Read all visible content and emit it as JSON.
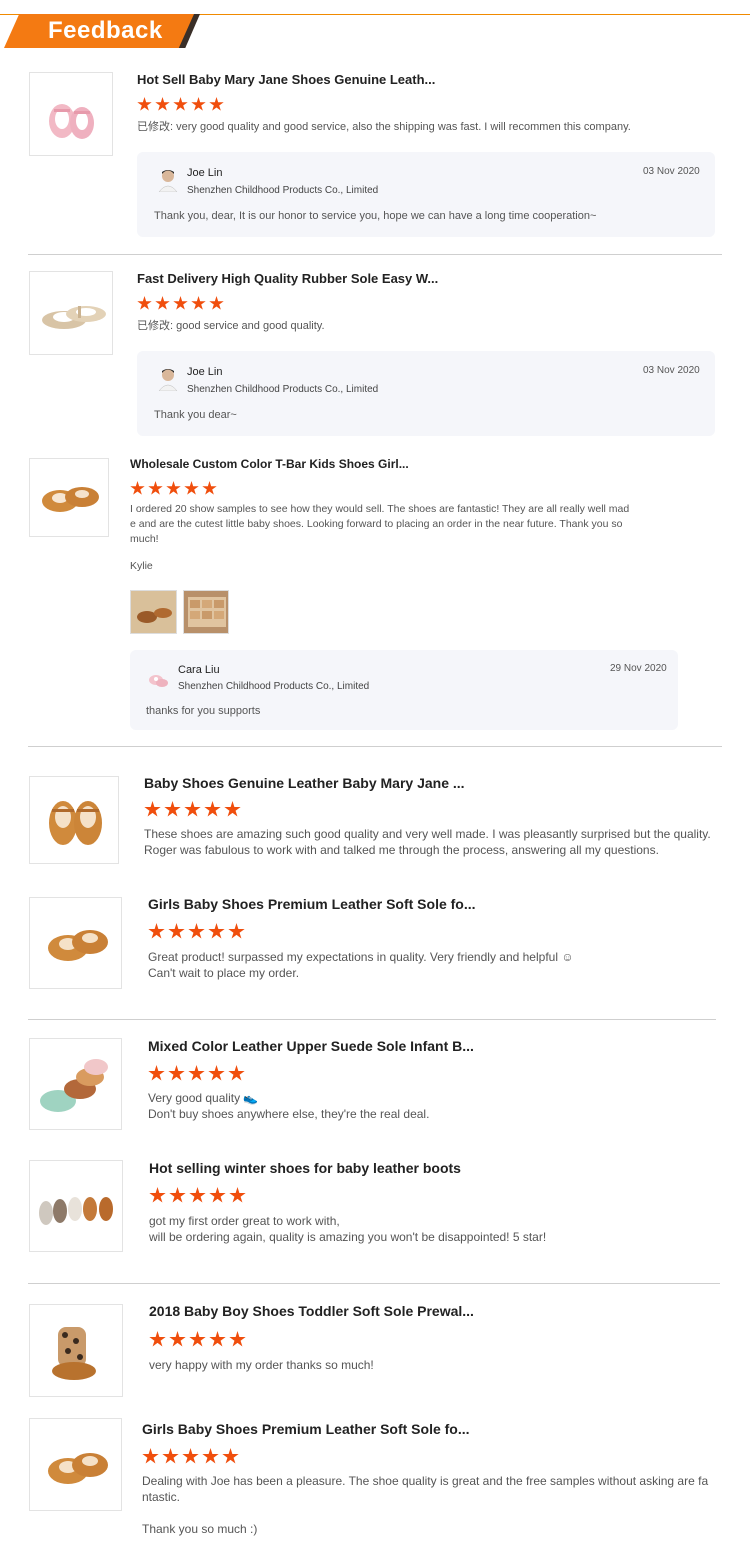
{
  "header": {
    "title": "Feedback"
  },
  "reviews": [
    {
      "product_title": "Hot Sell Baby Mary Jane Shoes Genuine Leath...",
      "product_icon": "pink-mary-jane-shoe",
      "stars": 5,
      "comment_prefix": "已修改:",
      "comment": " very good quality and good service, also the shipping was fast. I will recommen this company.",
      "reply": {
        "name": "Joe Lin",
        "company": "Shenzhen Childhood Products Co., Limited",
        "date": "03 Nov 2020",
        "text": "Thank  you, dear,  It is our honor to service you, hope we can have a long time cooperation~"
      }
    },
    {
      "product_title": "Fast Delivery High Quality Rubber Sole Easy W...",
      "product_icon": "gold-t-bar-shoe",
      "stars": 5,
      "comment_prefix": "已修改:",
      "comment": " good service and good quality.",
      "reply": {
        "name": "Joe Lin",
        "company": "Shenzhen Childhood Products Co., Limited",
        "date": "03 Nov 2020",
        "text": "Thank you dear~"
      }
    },
    {
      "product_title": "Wholesale Custom Color T-Bar Kids Shoes Girl...",
      "product_icon": "tan-t-bar-shoe",
      "stars": 5,
      "comment_lines": [
        "I ordered 20 show samples to see how they would sell. The shoes are fantastic! They are all really well mad",
        "e and are the cutest little baby shoes. Looking forward to placing an order in the near future. Thank you so",
        "much!"
      ],
      "author": "Kylie",
      "photos": [
        "shoes-photo",
        "shoebox-photo"
      ],
      "reply": {
        "name": "Cara Liu",
        "company": "Shenzhen Childhood Products Co., Limited",
        "date": "29 Nov 2020",
        "text": "thanks for you supports"
      }
    },
    {
      "product_title": "Baby Shoes Genuine Leather Baby Mary Jane ...",
      "product_icon": "tan-mary-jane-shoe",
      "stars": 5,
      "comment_lines": [
        "These shoes are amazing such good quality and very well made. I was pleasantly surprised but the quality.",
        "Roger was fabulous to work with and talked me through the process, answering all my questions."
      ]
    },
    {
      "product_title": "Girls Baby Shoes Premium Leather Soft Sole fo...",
      "product_icon": "tan-t-bar-shoe",
      "stars": 5,
      "comment_lines": [
        "Great product! surpassed my expectations in quality. Very friendly and helpful ☺",
        "Can't wait to place my order."
      ]
    },
    {
      "product_title": "Mixed Color Leather Upper Suede Sole Infant B...",
      "product_icon": "mixed-color-shoes",
      "stars": 5,
      "comment_lines": [
        "Very good quality 👟",
        "Don't buy shoes anywhere else, they're the real deal."
      ]
    },
    {
      "product_title": "Hot selling winter shoes for baby leather boots",
      "product_icon": "winter-boots",
      "stars": 5,
      "comment_lines": [
        "got my first order great to work with,",
        "will be ordering again, quality is amazing you won't be disappointed! 5 star!"
      ]
    },
    {
      "product_title": "2018 Baby Boy Shoes Toddler Soft Sole Prewal...",
      "product_icon": "leopard-boot",
      "stars": 5,
      "comment_lines": [
        "very happy with my order thanks so much!"
      ]
    },
    {
      "product_title": "Girls Baby Shoes Premium Leather Soft Sole fo...",
      "product_icon": "tan-t-bar-shoe",
      "stars": 5,
      "comment_lines": [
        "Dealing with Joe has been a pleasure. The shoe quality is great and the free samples without asking are fa",
        "ntastic.",
        "",
        "Thank you so much :)"
      ]
    }
  ],
  "colors": {
    "accent": "#f47a12",
    "star": "#f04e0d",
    "reply_bg": "#f5f6fa"
  }
}
